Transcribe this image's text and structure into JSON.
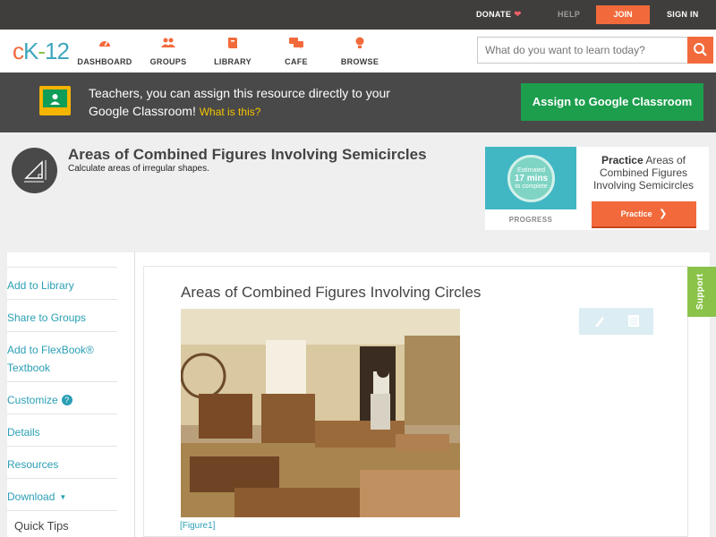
{
  "topbar": {
    "donate": "DONATE",
    "help": "HELP",
    "join": "JOIN",
    "signin": "SIGN IN"
  },
  "logo": {
    "c": "c",
    "k": "K",
    "dash": "-",
    "num": "12"
  },
  "nav": {
    "items": [
      {
        "label": "DASHBOARD",
        "icon": "dashboard-icon"
      },
      {
        "label": "GROUPS",
        "icon": "groups-icon"
      },
      {
        "label": "LIBRARY",
        "icon": "library-icon"
      },
      {
        "label": "CAFE",
        "icon": "cafe-icon"
      },
      {
        "label": "BROWSE",
        "icon": "browse-icon"
      }
    ],
    "search_placeholder": "What do you want to learn today?"
  },
  "banner": {
    "message": "Teachers, you can assign this resource directly to your Google Classroom!",
    "what_link": "What is this?",
    "assign_button": "Assign to Google Classroom"
  },
  "concept": {
    "title": "Areas of Combined Figures Involving Semicircles",
    "subtitle": "Calculate areas of irregular shapes."
  },
  "practice": {
    "estimated_line1": "Estimated",
    "minutes": "17 mins",
    "estimated_line2": "to complete",
    "progress_label": "PROGRESS",
    "practice_word": "Practice",
    "practice_title": "Areas of Combined Figures Involving Semicircles",
    "button": "Practice"
  },
  "sidebar": {
    "items": [
      {
        "label": "Add to Library"
      },
      {
        "label": "Share to Groups"
      },
      {
        "label": "Add to FlexBook® Textbook"
      },
      {
        "label": "Customize"
      },
      {
        "label": "Details"
      },
      {
        "label": "Resources"
      },
      {
        "label": "Download"
      }
    ],
    "quick_tips": "Quick Tips",
    "customize_help": "?",
    "download_caret": "▼"
  },
  "lesson": {
    "title": "Areas of Combined Figures Involving Circles",
    "figure_caption": "[Figure1]"
  },
  "support_tab": "Support",
  "colors": {
    "accent_orange": "#f26a3b",
    "teal": "#2a9fb5",
    "green": "#1c9e4d",
    "dark_bar": "#3f3e3c"
  }
}
